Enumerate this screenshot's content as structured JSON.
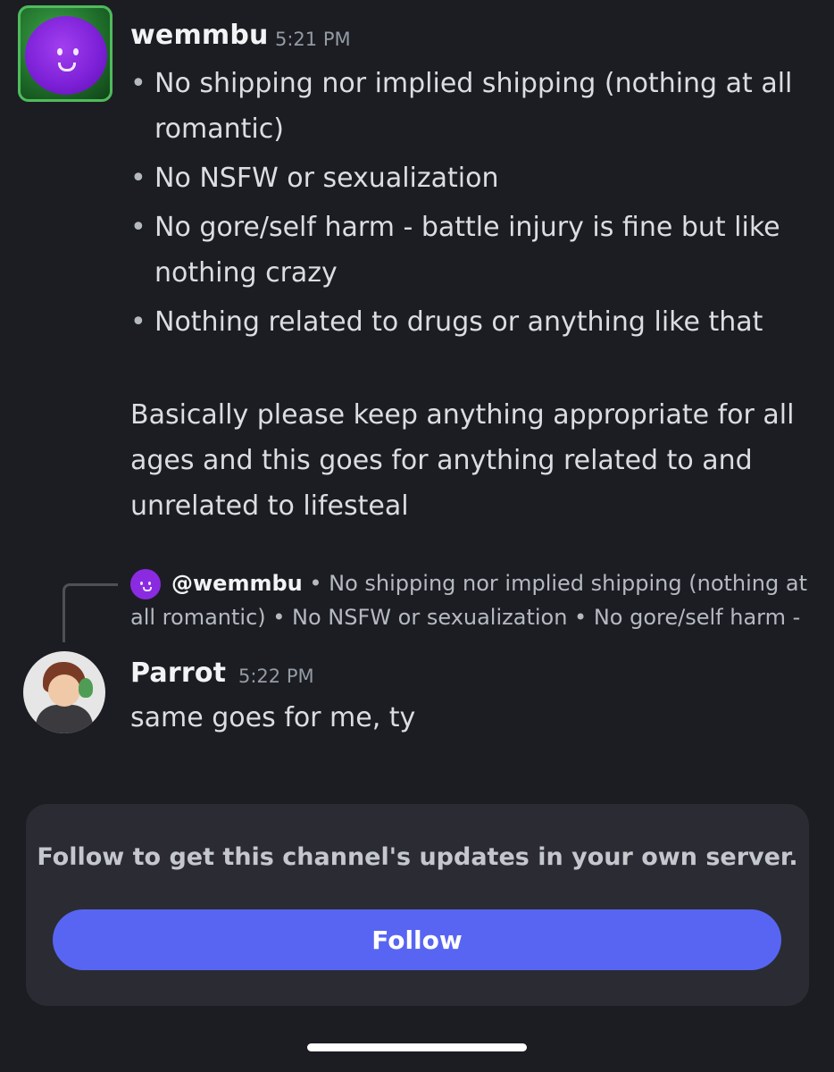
{
  "message1": {
    "username": "wemmbu",
    "timestamp": "5:21 PM",
    "bullet_char": "•",
    "rules": [
      "No shipping nor implied shipping (nothing at all romantic)",
      "No NSFW or sexualization",
      "No gore/self harm - battle injury is fine but like nothing crazy",
      "Nothing related to drugs or anything like that"
    ],
    "paragraph": "Basically please keep anything appropriate for all ages and this goes for anything related to and unrelated to lifesteal"
  },
  "reply_preview": {
    "mention": "@wemmbu",
    "text": "• No shipping nor implied shipping (nothing at all romantic)  • No NSFW or sexualization  • No gore/self harm -"
  },
  "message2": {
    "username": "Parrot",
    "timestamp": "5:22 PM",
    "text": "same goes for me, ty"
  },
  "follow_card": {
    "prompt": "Follow to get this channel's updates in your own server.",
    "button_label": "Follow"
  },
  "colors": {
    "background": "#1c1d23",
    "card": "#2b2c33",
    "accent": "#5865f2"
  }
}
